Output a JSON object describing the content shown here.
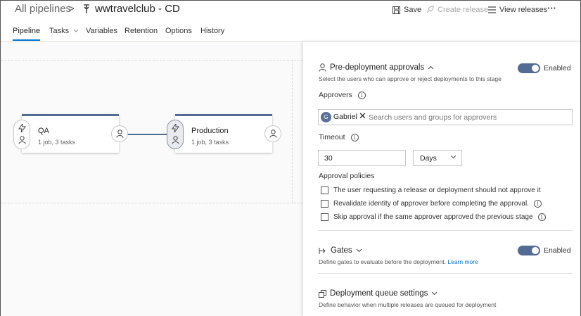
{
  "breadcrumb": {
    "root": "All pipelines",
    "separator": ">",
    "title": "wwtravelclub - CD"
  },
  "toolbar": {
    "save": "Save",
    "create_release": "Create release",
    "view_releases": "View releases",
    "more": "···"
  },
  "tabs": [
    {
      "label": "Pipeline",
      "active": true
    },
    {
      "label": "Tasks",
      "has_dropdown": true
    },
    {
      "label": "Variables"
    },
    {
      "label": "Retention"
    },
    {
      "label": "Options"
    },
    {
      "label": "History"
    }
  ],
  "stages": [
    {
      "name": "QA",
      "summary": "1 job, 3 tasks"
    },
    {
      "name": "Production",
      "summary": "1 job, 3 tasks",
      "selected": true
    }
  ],
  "panel": {
    "pre_deployment": {
      "title": "Pre-deployment approvals",
      "enabled_label": "Enabled",
      "description": "Select the users who can approve or reject deployments to this stage",
      "approvers_label": "Approvers",
      "approver": {
        "initial": "G",
        "name": "Gabriel"
      },
      "search_placeholder": "Search users and groups for approvers",
      "timeout_label": "Timeout",
      "timeout_value": "30",
      "timeout_unit": "Days",
      "policies_label": "Approval policies",
      "policies": [
        {
          "label": "The user requesting a release or deployment should not approve it",
          "checked": false,
          "info": false
        },
        {
          "label": "Revalidate identity of approver before completing the approval.",
          "checked": false,
          "info": true
        },
        {
          "label": "Skip approval if the same approver approved the previous stage",
          "checked": false,
          "info": true
        }
      ]
    },
    "gates": {
      "title": "Gates",
      "enabled_label": "Enabled",
      "description": "Define gates to evaluate before the deployment.",
      "learn_more": "Learn more"
    },
    "queue": {
      "title": "Deployment queue settings",
      "description": "Define behavior when multiple releases are queued for deployment"
    }
  },
  "colors": {
    "accent": "#0078d4",
    "stage_bar": "#536c94",
    "toggle_on": "#536c94"
  }
}
